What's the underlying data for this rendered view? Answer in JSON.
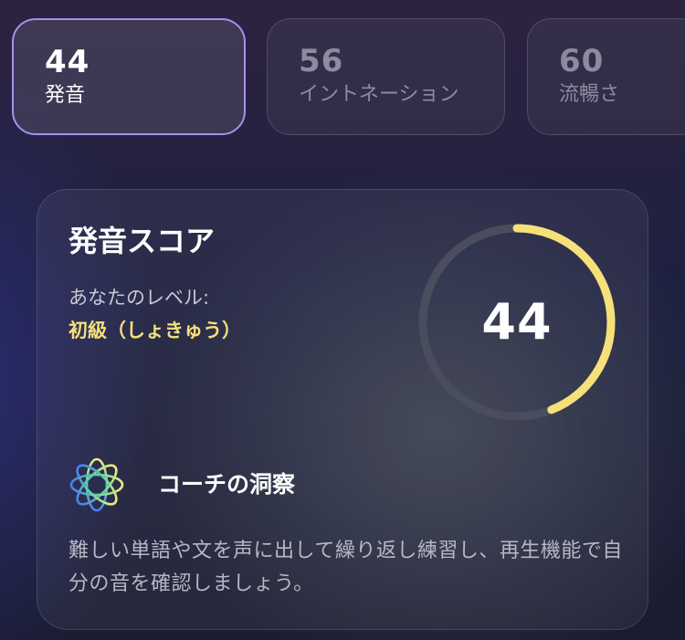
{
  "tabs": [
    {
      "score": "44",
      "label": "発音",
      "active": true
    },
    {
      "score": "56",
      "label": "イントネーション",
      "active": false
    },
    {
      "score": "60",
      "label": "流暢さ",
      "active": false
    }
  ],
  "card": {
    "title": "発音スコア",
    "level_prefix": "あなたのレベル: ",
    "level_value": "初級（しょきゅう）",
    "score": "44",
    "score_value": 44,
    "score_max": 100,
    "ring_color": "#f6e07a",
    "track_color": "#4a4d5e",
    "insight_icon": "sparkle-flower-icon",
    "insight_title": "コーチの洞察",
    "insight_text": "難しい単語や文を声に出して繰り返し練習し、再生機能で自分の音を確認しましょう。"
  }
}
